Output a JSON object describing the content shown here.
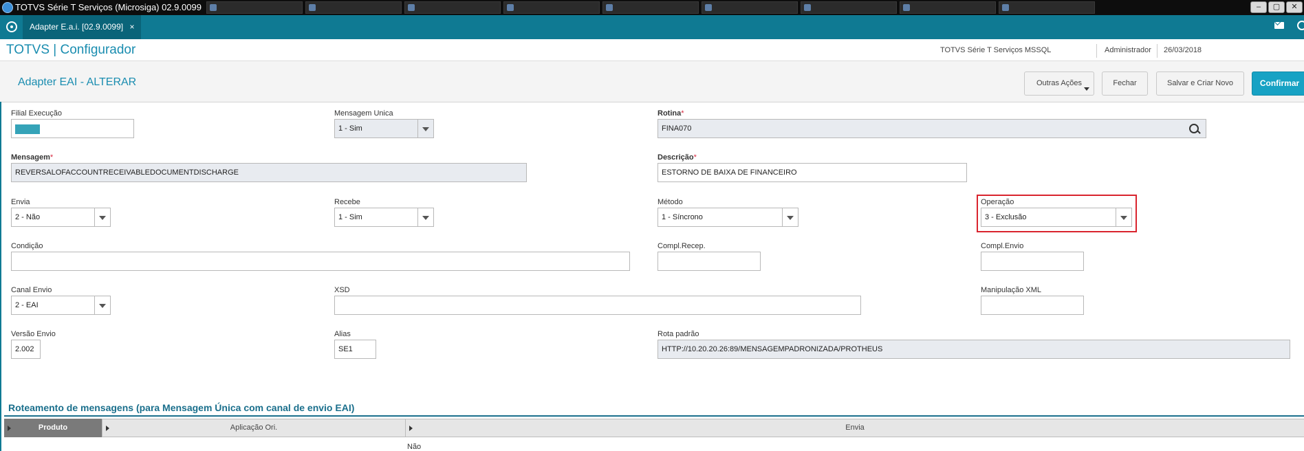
{
  "os": {
    "title": "TOTVS Série T Serviços (Microsiga) 02.9.0099",
    "controls": [
      "–",
      "▢",
      "✕"
    ]
  },
  "app": {
    "tab_label": "Adapter E.a.i. [02.9.0099]",
    "tab_close": "×",
    "brand": "TOTVS | Configurador",
    "environment": "TOTVS Série T Serviços MSSQL",
    "user": "Administrador",
    "date": "26/03/2018"
  },
  "page": {
    "title": "Adapter EAI - ALTERAR",
    "buttons": {
      "outras_acoes": "Outras Ações",
      "fechar": "Fechar",
      "salvar_criar": "Salvar e Criar Novo",
      "confirmar": "Confirmar"
    }
  },
  "form": {
    "filial": {
      "label": "Filial Execução"
    },
    "mensagem_unica": {
      "label": "Mensagem Unica",
      "value": "1 - Sim"
    },
    "rotina": {
      "label": "Rotina",
      "required": "*",
      "value": "FINA070"
    },
    "mensagem": {
      "label": "Mensagem",
      "required": "*",
      "value": "REVERSALOFACCOUNTRECEIVABLEDOCUMENTDISCHARGE"
    },
    "descricao": {
      "label": "Descrição",
      "required": "*",
      "value": "ESTORNO DE BAIXA DE FINANCEIRO"
    },
    "envia": {
      "label": "Envia",
      "value": "2 - Não"
    },
    "recebe": {
      "label": "Recebe",
      "value": "1 - Sim"
    },
    "metodo": {
      "label": "Método",
      "value": "1 - Síncrono"
    },
    "operacao": {
      "label": "Operação",
      "value": "3 - Exclusão"
    },
    "condicao": {
      "label": "Condição",
      "value": ""
    },
    "compl_recep": {
      "label": "Compl.Recep.",
      "value": ""
    },
    "compl_envio": {
      "label": "Compl.Envio",
      "value": ""
    },
    "canal_envio": {
      "label": "Canal Envio",
      "value": "2 - EAI"
    },
    "xsd": {
      "label": "XSD",
      "value": ""
    },
    "manipulacao_xml": {
      "label": "Manipulação XML",
      "value": ""
    },
    "versao_envio": {
      "label": "Versão Envio",
      "value": "2.002"
    },
    "alias": {
      "label": "Alias",
      "value": "SE1"
    },
    "rota_padrao": {
      "label": "Rota padrão",
      "value": "HTTP://10.20.20.26:89/MENSAGEMPADRONIZADA/PROTHEUS"
    }
  },
  "routing": {
    "title": "Roteamento de mensagens (para Mensagem Única com canal de envio EAI)",
    "columns": [
      "Produto",
      "Aplicação Ori.",
      "Envia"
    ],
    "rows": [
      {
        "produto": "",
        "aplicacao": "",
        "envia": "Não"
      }
    ]
  }
}
